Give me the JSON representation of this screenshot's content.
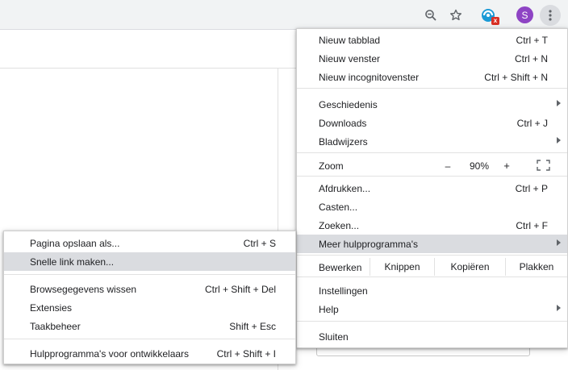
{
  "toolbar": {
    "avatar_letter": "S",
    "ext_badge": "x",
    "icons": [
      "zoom-icon",
      "bookmark-star-icon",
      "extension-icon",
      "more-vert-icon"
    ]
  },
  "main_menu": {
    "new_tab": {
      "label": "Nieuw tabblad",
      "shortcut": "Ctrl + T"
    },
    "new_window": {
      "label": "Nieuw venster",
      "shortcut": "Ctrl + N"
    },
    "new_incognito": {
      "label": "Nieuw incognitovenster",
      "shortcut": "Ctrl + Shift + N"
    },
    "history": {
      "label": "Geschiedenis"
    },
    "downloads": {
      "label": "Downloads",
      "shortcut": "Ctrl + J"
    },
    "bookmarks": {
      "label": "Bladwijzers"
    },
    "zoom": {
      "label": "Zoom",
      "minus": "–",
      "value": "90%",
      "plus": "+"
    },
    "print": {
      "label": "Afdrukken...",
      "shortcut": "Ctrl + P"
    },
    "cast": {
      "label": "Casten..."
    },
    "find": {
      "label": "Zoeken...",
      "shortcut": "Ctrl + F"
    },
    "more_tools": {
      "label": "Meer hulpprogramma's"
    },
    "edit": {
      "label": "Bewerken",
      "cut": "Knippen",
      "copy": "Kopiëren",
      "paste": "Plakken"
    },
    "settings": {
      "label": "Instellingen"
    },
    "help": {
      "label": "Help"
    },
    "exit": {
      "label": "Sluiten"
    }
  },
  "sub_menu": {
    "save_page": {
      "label": "Pagina opslaan als...",
      "shortcut": "Ctrl + S"
    },
    "create_shortcut": {
      "label": "Snelle link maken..."
    },
    "clear_data": {
      "label": "Browsegegevens wissen",
      "shortcut": "Ctrl + Shift + Del"
    },
    "extensions": {
      "label": "Extensies"
    },
    "task_manager": {
      "label": "Taakbeheer",
      "shortcut": "Shift + Esc"
    },
    "dev_tools": {
      "label": "Hulpprogramma's voor ontwikkelaars",
      "shortcut": "Ctrl + Shift + I"
    }
  }
}
